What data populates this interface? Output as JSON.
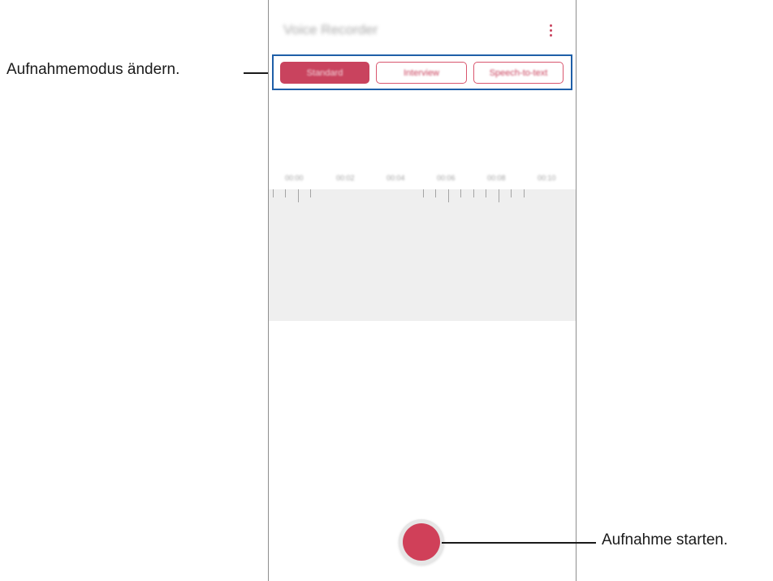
{
  "app": {
    "title": "Voice Recorder",
    "more_icon": "more-vertical-icon"
  },
  "modes": [
    {
      "label": "Standard",
      "selected": true
    },
    {
      "label": "Interview",
      "selected": false
    },
    {
      "label": "Speech-to-text",
      "selected": false
    }
  ],
  "timeline": {
    "labels": [
      "00:00",
      "00:02",
      "00:04",
      "00:06",
      "00:08",
      "00:10"
    ]
  },
  "record_button": {
    "icon": "record-icon"
  },
  "callouts": {
    "mode": "Aufnahmemodus ändern.",
    "record": "Aufnahme starten."
  },
  "colors": {
    "accent": "#c9435e",
    "record": "#d04059",
    "highlight": "#1f5fa8"
  }
}
